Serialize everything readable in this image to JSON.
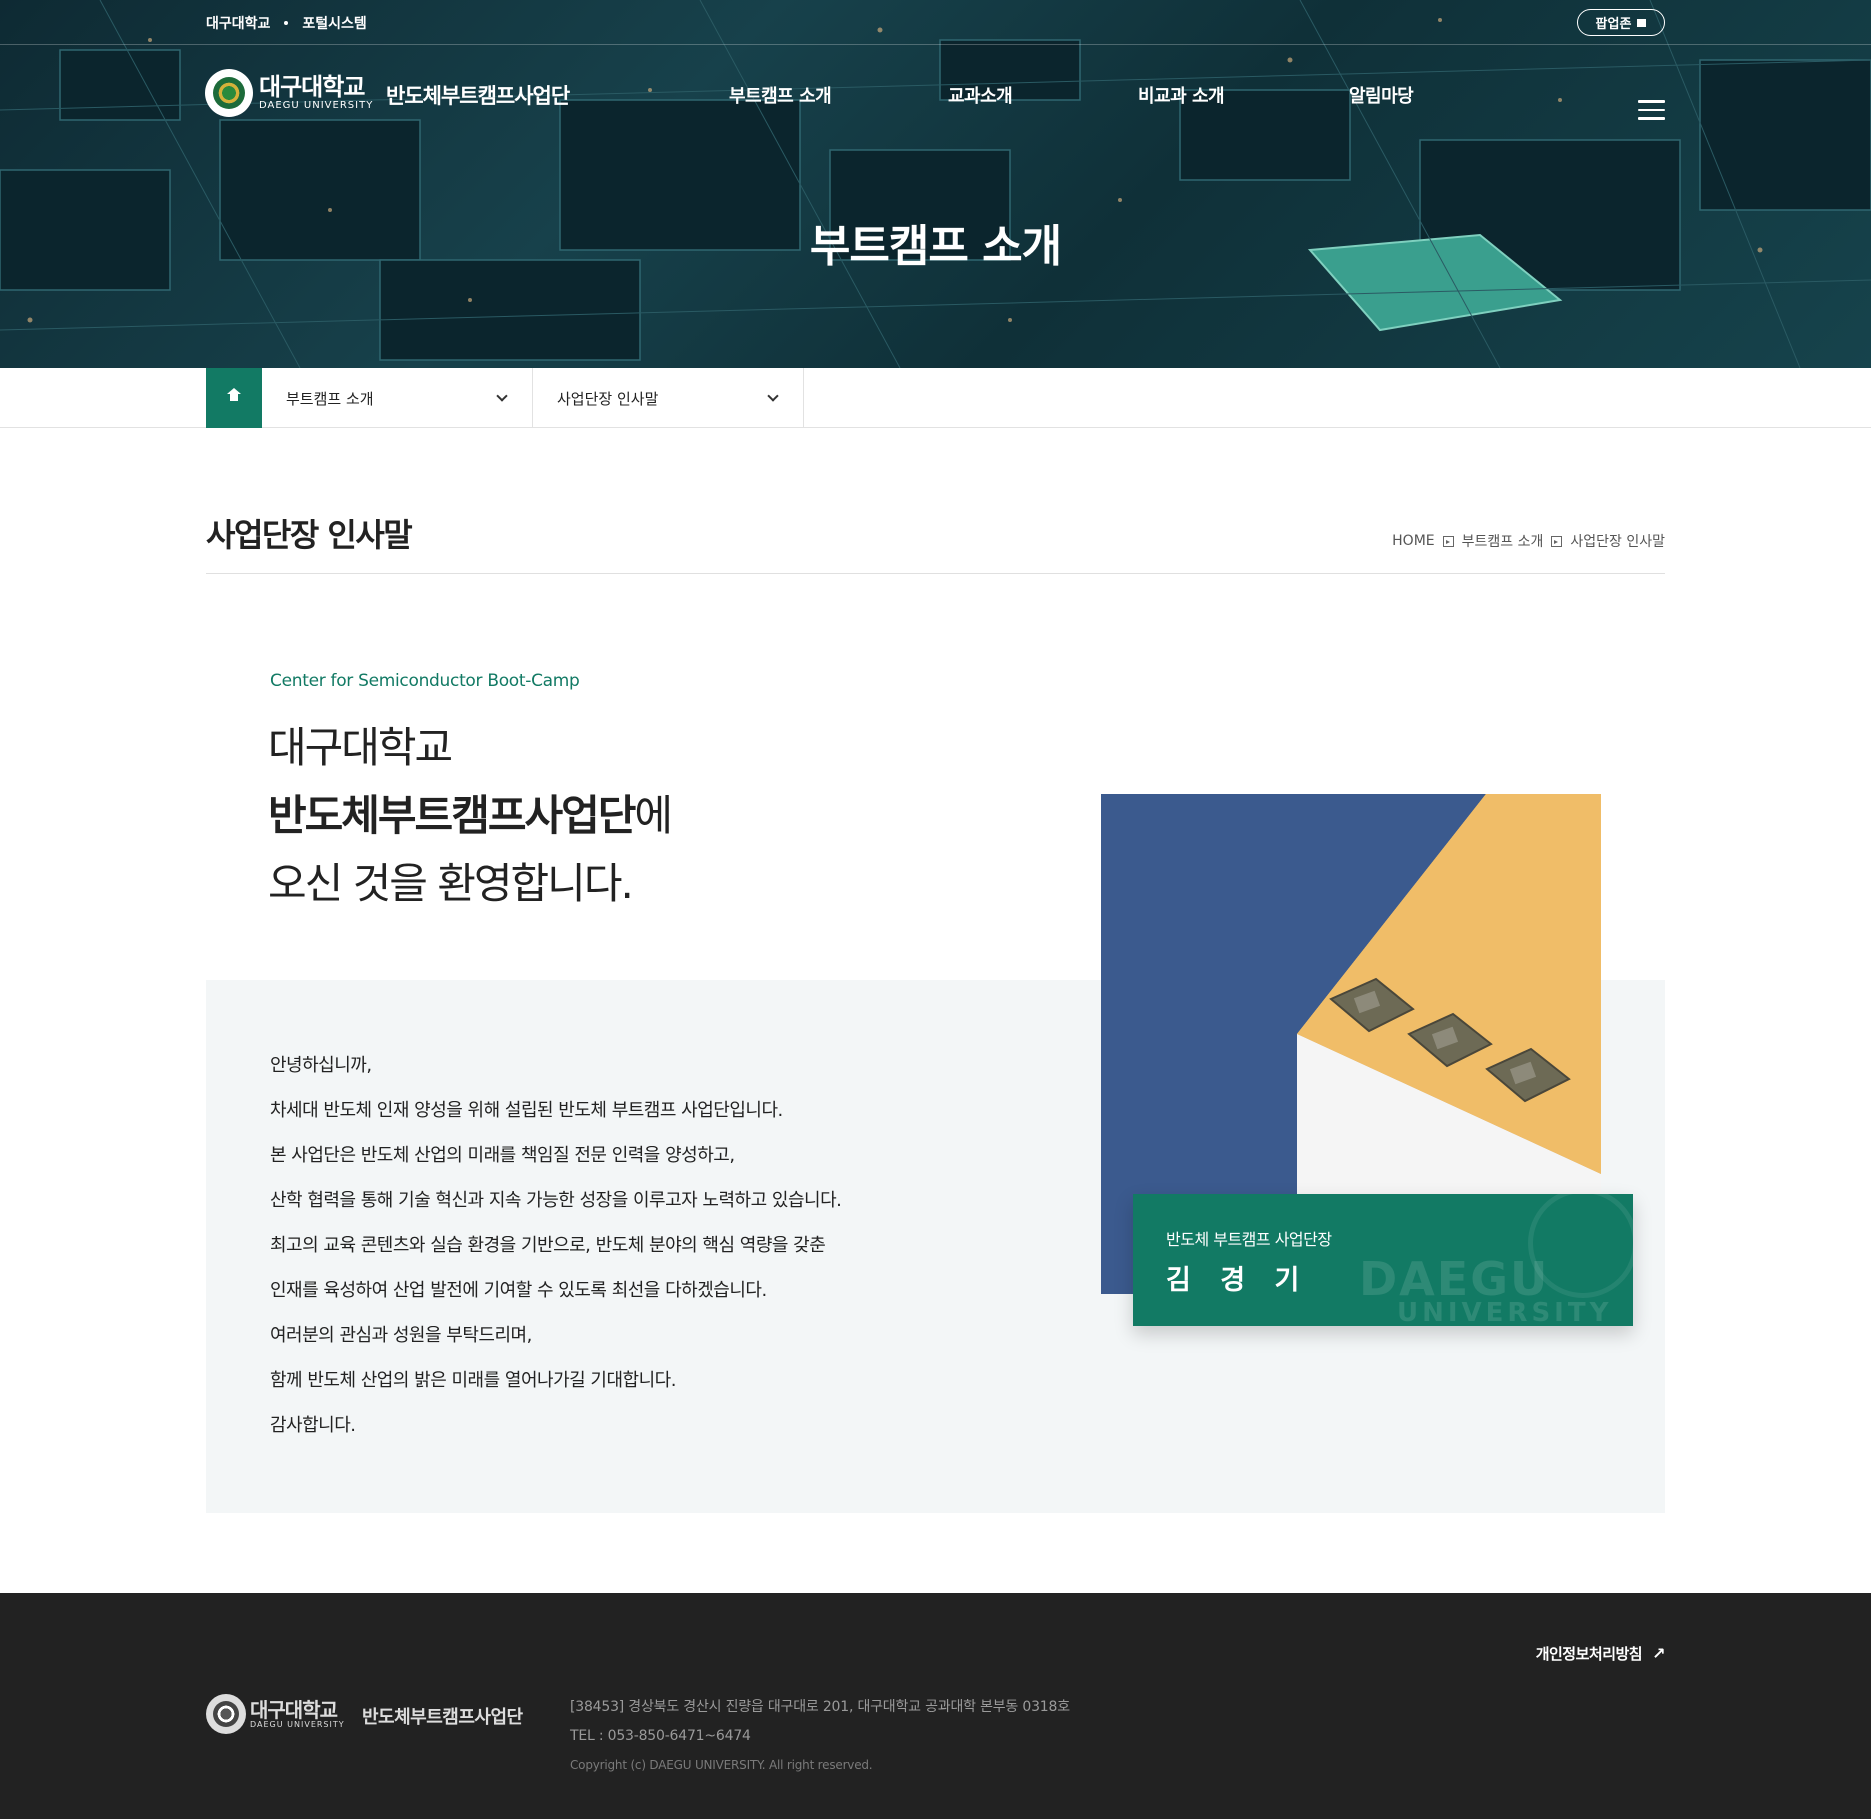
{
  "utility_links": [
    "대구대학교",
    "포털시스템"
  ],
  "popup_button": "팝업존",
  "logo": {
    "kr": "대구대학교",
    "en": "DAEGU UNIVERSITY",
    "dept": "반도체부트캠프사업단"
  },
  "gnb": [
    "부트캠프 소개",
    "교과소개",
    "비교과 소개",
    "알림마당"
  ],
  "hero_title": "부트캠프 소개",
  "subnav": {
    "depth1": "부트캠프 소개",
    "depth2": "사업단장 인사말"
  },
  "page_title": "사업단장 인사말",
  "breadcrumb": [
    "HOME",
    "부트캠프 소개",
    "사업단장 인사말"
  ],
  "intro": {
    "eng": "Center for Semiconductor Boot-Camp",
    "line1": "대구대학교",
    "line2_bold": "반도체부트캠프사업단",
    "line2_rest": "에",
    "line3": "오신 것을 환영합니다."
  },
  "message": [
    "안녕하십니까,",
    "차세대 반도체 인재 양성을 위해 설립된 반도체 부트캠프 사업단입니다.",
    "본 사업단은 반도체 산업의 미래를 책임질 전문 인력을 양성하고,",
    "산학 협력을 통해 기술 혁신과 지속 가능한 성장을 이루고자 노력하고 있습니다.",
    "최고의 교육 콘텐츠와 실습 환경을 기반으로, 반도체 분야의 핵심 역량을 갖춘",
    "인재를 육성하여 산업 발전에 기여할 수 있도록 최선을 다하겠습니다.",
    "여러분의 관심과 성원을 부탁드리며,",
    "함께 반도체 산업의 밝은 미래를 열어나가길 기대합니다.",
    "감사합니다."
  ],
  "namecard": {
    "role": "반도체 부트캠프 사업단장",
    "name": "김 경 기",
    "watermark1": "DAEGU",
    "watermark2": "UNIVERSITY"
  },
  "footer": {
    "privacy": "개인정보처리방침",
    "logo_kr": "대구대학교",
    "logo_en": "DAEGU UNIVERSITY",
    "dept": "반도체부트캠프사업단",
    "address": "[38453] 경상북도 경산시 진량읍 대구대로 201, 대구대학교 공과대학 본부동 0318호",
    "tel": "TEL : 053-850-6471~6474",
    "copyright": "Copyright (c) DAEGU UNIVERSITY. All right reserved."
  },
  "colors": {
    "brand": "#127a64",
    "footer_bg": "#222222",
    "grey_box": "#f3f6f7"
  },
  "icons": {
    "home": "home-icon",
    "dropdown": "chevron-down-icon",
    "menu": "hamburger-icon",
    "external": "arrow-up-right-icon"
  }
}
